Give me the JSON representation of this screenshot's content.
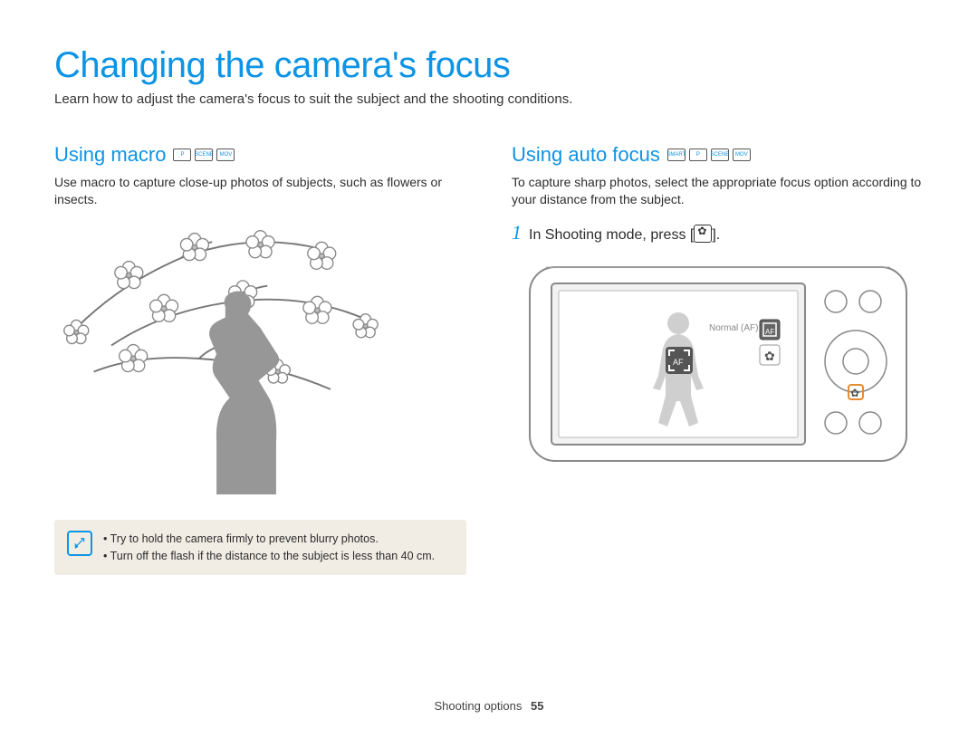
{
  "page": {
    "title": "Changing the camera's focus",
    "subtitle": "Learn how to adjust the camera's focus to suit the subject and the shooting conditions."
  },
  "left": {
    "heading": "Using macro",
    "mode_icons": [
      "P",
      "SCENE",
      "MOV"
    ],
    "body": "Use macro to capture close-up photos of subjects, such as flowers or insects.",
    "tips": [
      "Try to hold the camera firmly to prevent blurry photos.",
      "Turn off the flash if the distance to the subject is less than 40 cm."
    ]
  },
  "right": {
    "heading": "Using auto focus",
    "mode_icons": [
      "SMART",
      "P",
      "SCENE",
      "MOV"
    ],
    "body": "To capture sharp photos, select the appropriate focus option according to your distance from the subject.",
    "step_number": "1",
    "step_text_before": "In Shooting mode, press [",
    "step_text_after": "].",
    "camera_label": "Normal (AF)",
    "camera_af_badge": "AF"
  },
  "footer": {
    "section": "Shooting options",
    "page_number": "55"
  }
}
